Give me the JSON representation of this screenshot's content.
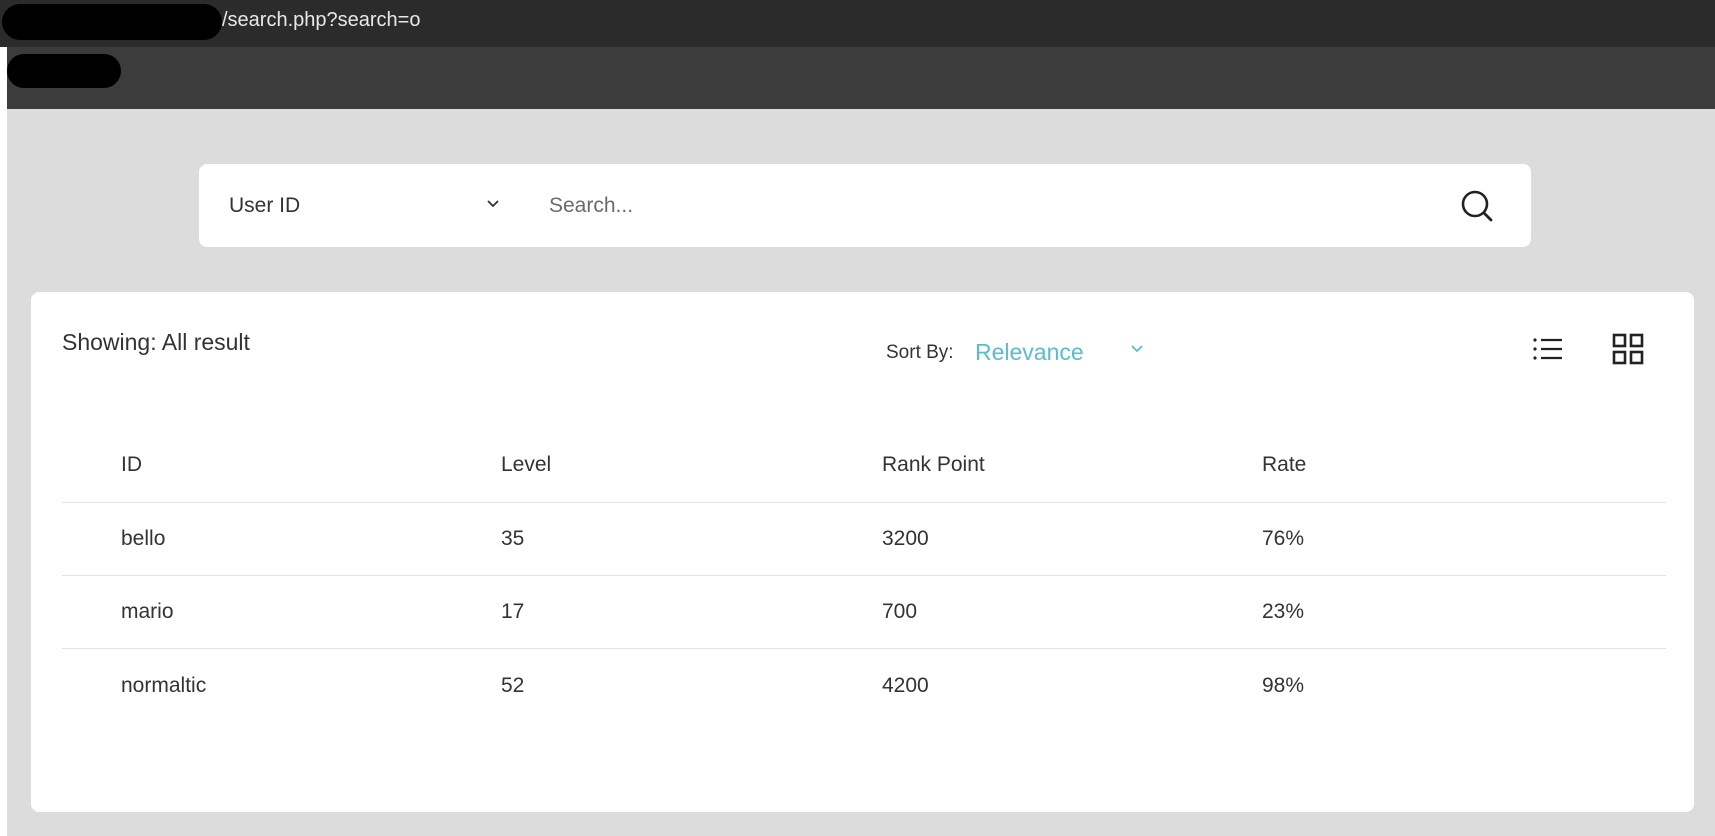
{
  "browser": {
    "url_path": "/search.php?search=o"
  },
  "search": {
    "field_selected": "User ID",
    "placeholder": "Search..."
  },
  "results": {
    "showing_text": "Showing: All result",
    "sort_label": "Sort By:",
    "sort_value": "Relevance",
    "columns": [
      "ID",
      "Level",
      "Rank Point",
      "Rate"
    ],
    "rows": [
      [
        "bello",
        "35",
        "3200",
        "76%"
      ],
      [
        "mario",
        "17",
        "700",
        "23%"
      ],
      [
        "normaltic",
        "52",
        "4200",
        "98%"
      ]
    ]
  },
  "icons": {
    "field_dropdown": "chevron-down-icon",
    "search": "search-icon",
    "sort_dropdown": "chevron-down-icon",
    "list_view": "list-view-icon",
    "grid_view": "grid-view-icon"
  },
  "colors": {
    "accent": "#5bbccc",
    "url_bar": "#2b2b2b",
    "header": "#3c3c3c",
    "page_bg": "#dcdcdc"
  }
}
